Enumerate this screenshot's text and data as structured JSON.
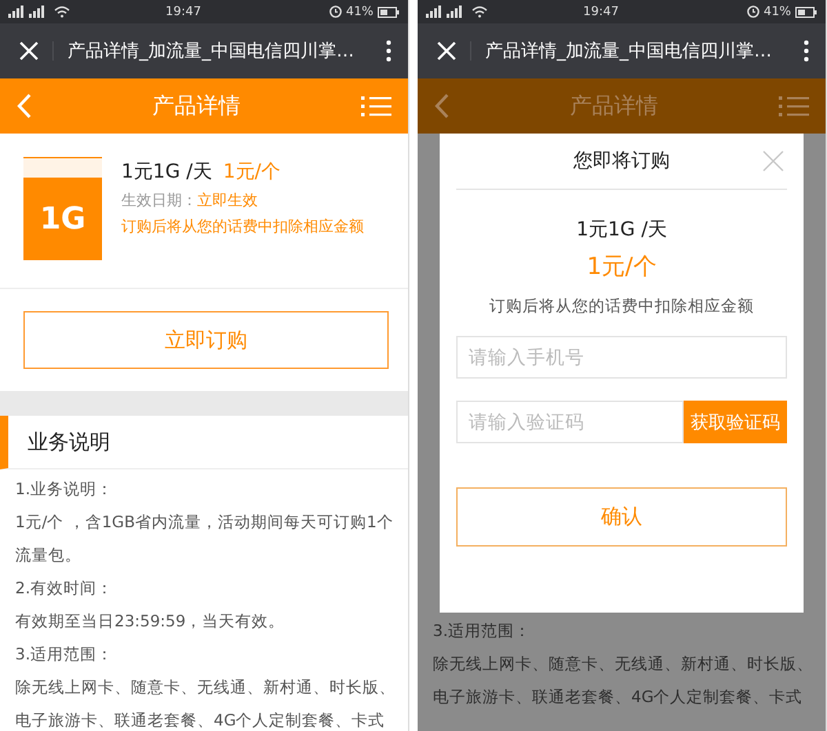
{
  "screens": [
    {
      "dimmed": false,
      "status_bar": {
        "time": "19:47",
        "battery": "41%"
      },
      "browser_bar": {
        "title": "产品详情_加流量_中国电信四川掌…"
      },
      "app_bar": {
        "title": "产品详情"
      },
      "product": {
        "badge": "1G",
        "name": "1元1G /天",
        "price": "1元/个",
        "date_label": "生效日期：",
        "date_value": "立即生效",
        "notice": "订购后将从您的话费中扣除相应金额"
      },
      "order_button": "立即订购",
      "section": {
        "title": "业务说明"
      },
      "lines": [
        "1.业务说明：",
        "1元/个 ，含1GB省内流量，活动期间每天可订购1个流量包。",
        "2.有效时间：",
        "有效期至当日23:59:59，当天有效。",
        "3.适用范围：",
        "除无线上网卡、随意卡、无线通、新村通、时长版、电子旅游卡、联通老套餐、4G个人定制套餐、卡式"
      ]
    },
    {
      "dimmed": true,
      "status_bar": {
        "time": "19:47",
        "battery": "41%"
      },
      "browser_bar": {
        "title": "产品详情_加流量_中国电信四川掌…"
      },
      "app_bar": {
        "title": "产品详情"
      },
      "dialog": {
        "title": "您即将订购",
        "name": "1元1G /天",
        "price": "1元/个",
        "notice": "订购后将从您的话费中扣除相应金额",
        "phone_placeholder": "请输入手机号",
        "code_placeholder": "请输入验证码",
        "code_button": "获取验证码",
        "confirm_button": "确认"
      },
      "lines": [
        "3.适用范围：",
        "除无线上网卡、随意卡、无线通、新村通、时长版、电子旅游卡、联通老套餐、4G个人定制套餐、卡式"
      ]
    }
  ]
}
